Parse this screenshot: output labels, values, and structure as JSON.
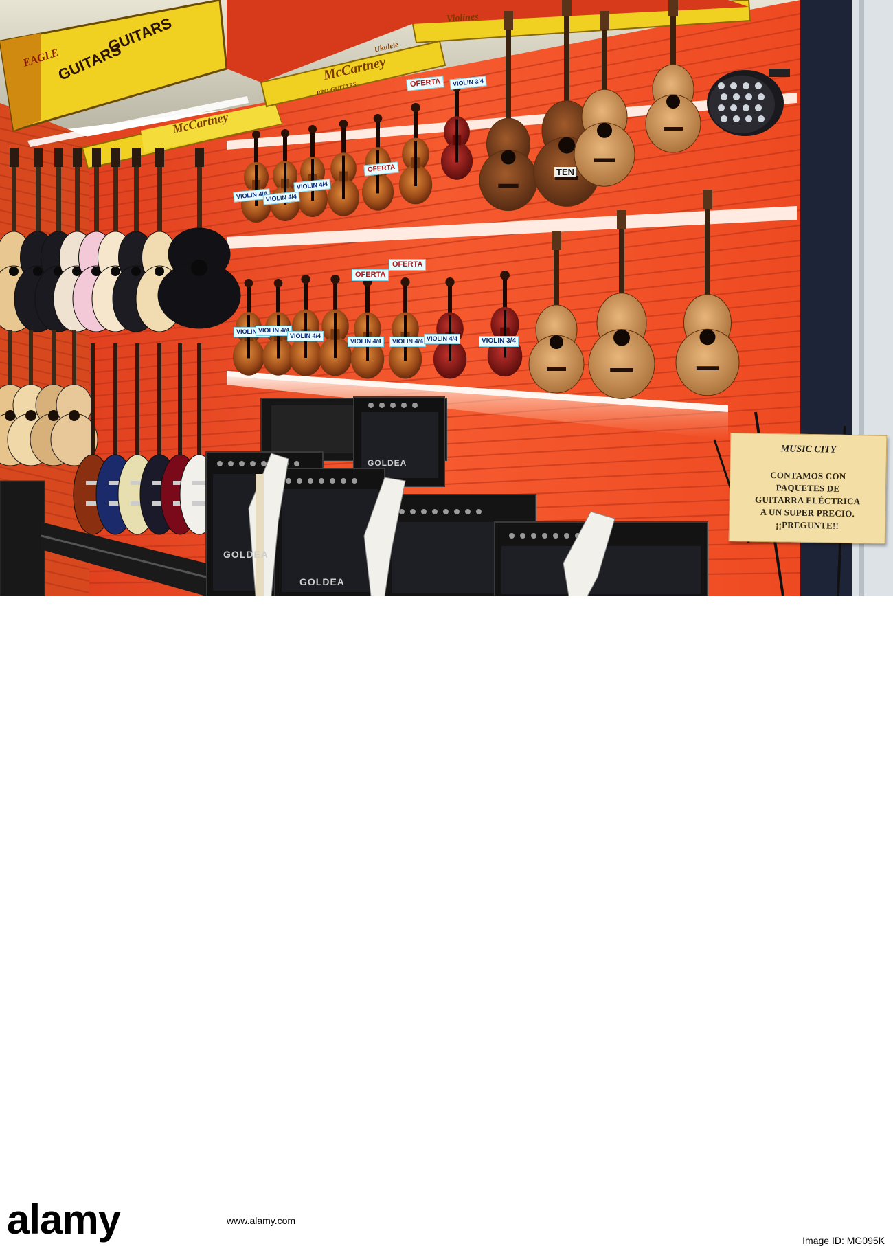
{
  "scene": {
    "description_alt": "music store wall",
    "banners": {
      "eagle": "EAGLE",
      "guitars": "GUITARS",
      "mccartney": "McCartney",
      "ukulele": "Ukulele",
      "pro_guitars": "PRO-GUITARS",
      "violines": "Violines"
    },
    "violin_tags_top": [
      "VIOLIN 4/4",
      "VIOLIN 4/4",
      "VIOLIN 4/4",
      "VIOLIN 3/4"
    ],
    "violin_tags_bottom": [
      "VIOLIN 4/4",
      "VIOLIN 4/4",
      "VIOLIN 4/4",
      "VIOLIN 4/4",
      "VIOLIN 4/4",
      "VIOLIN 4/4",
      "VIOLIN 3/4"
    ],
    "oferta_tags": [
      "OFERTA",
      "OFERTA",
      "OFERTA",
      "OFERTA"
    ],
    "uke_tag": "TEN",
    "amp_brand": "GOLDEA",
    "sign": {
      "brand": "MUSIC CITY",
      "lines": [
        "CONTAMOS CON",
        "PAQUETES DE",
        "GUITARRA ELÉCTRICA",
        "A UN SUPER PRECIO.",
        "¡¡PREGUNTE!!"
      ]
    }
  },
  "stock": {
    "watermark": "alamy",
    "meta_line1": "Image ID: MG095K",
    "meta_line2": "www.alamy.com"
  },
  "colors": {
    "wall": "#f2502a",
    "slot": "#c0341a",
    "banner_yellow": "#f0d020",
    "wood_light": "#d7a56a",
    "wood_dark": "#6e3a18",
    "violin_red": "#8a1a10"
  }
}
